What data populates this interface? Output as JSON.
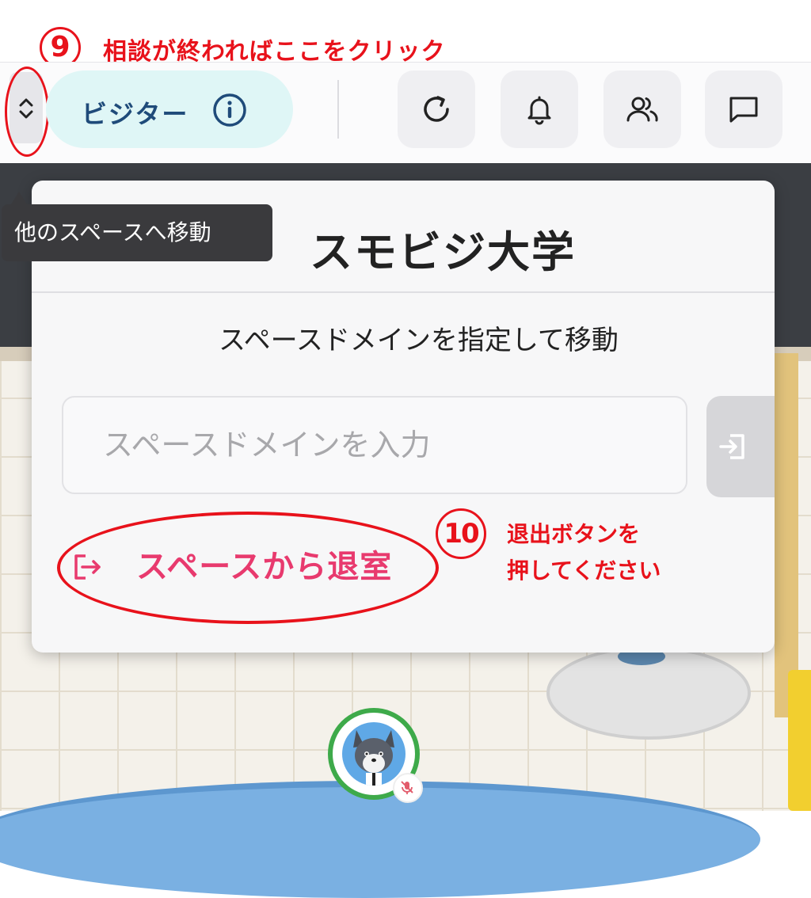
{
  "annotations": {
    "step9_number": "⑨",
    "step9_text": "相談が終わればここをクリック",
    "step10_number": "⑩",
    "step10_line1": "退出ボタンを",
    "step10_line2": "押してください",
    "color": "#e8121b"
  },
  "header": {
    "space_toggle_icon": "chevron-up-down-icon",
    "visitor_label": "ビジター",
    "info_icon": "info-icon",
    "buttons": [
      {
        "icon": "refresh-icon"
      },
      {
        "icon": "bell-icon"
      },
      {
        "icon": "users-icon"
      },
      {
        "icon": "chat-icon"
      }
    ]
  },
  "tooltip": {
    "text": "他のスペースへ移動"
  },
  "popup": {
    "title": "スモビジ大学",
    "subtitle": "スペースドメインを指定して移動",
    "input_placeholder": "スペースドメインを入力",
    "input_value": "",
    "enter_icon": "login-icon",
    "leave_label": "スペースから退室",
    "leave_icon": "logout-icon",
    "leave_color": "#e83a6e"
  },
  "colors": {
    "visitor_pill": "#dff6f6",
    "visitor_text": "#1f4b7a",
    "avatar_ring": "#3eaa4a"
  }
}
